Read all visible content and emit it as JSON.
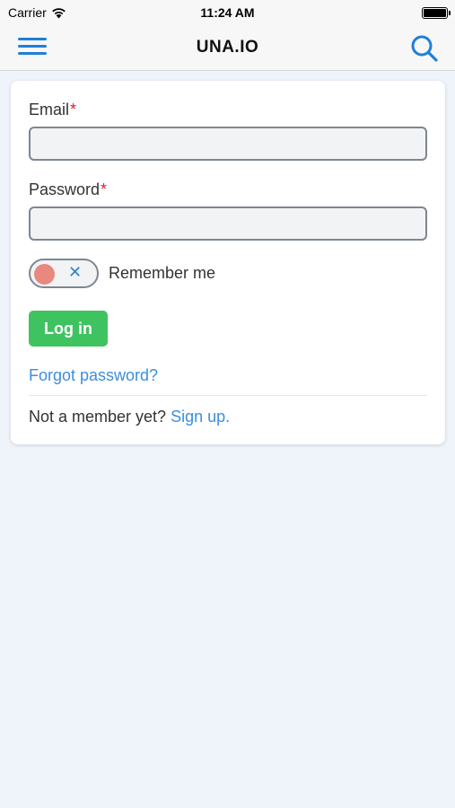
{
  "status_bar": {
    "carrier": "Carrier",
    "time": "11:24 AM"
  },
  "nav": {
    "title": "UNA.IO",
    "menu_icon": "hamburger-menu-icon",
    "search_icon": "search-icon",
    "accent_color": "#1e7fd8"
  },
  "form": {
    "email_label": "Email",
    "password_label": "Password",
    "required_mark": "*",
    "email_value": "",
    "password_value": "",
    "remember_label": "Remember me",
    "remember_checked": false,
    "toggle_off_glyph": "✕",
    "login_label": "Log in",
    "forgot_label": "Forgot password?",
    "not_member_text": "Not a member yet?",
    "signup_label": "Sign up."
  },
  "colors": {
    "login_button": "#3fc361",
    "link": "#3b8ee0",
    "required": "#e02020",
    "toggle_knob_off": "#e8887f",
    "page_background": "#eff4fb"
  }
}
